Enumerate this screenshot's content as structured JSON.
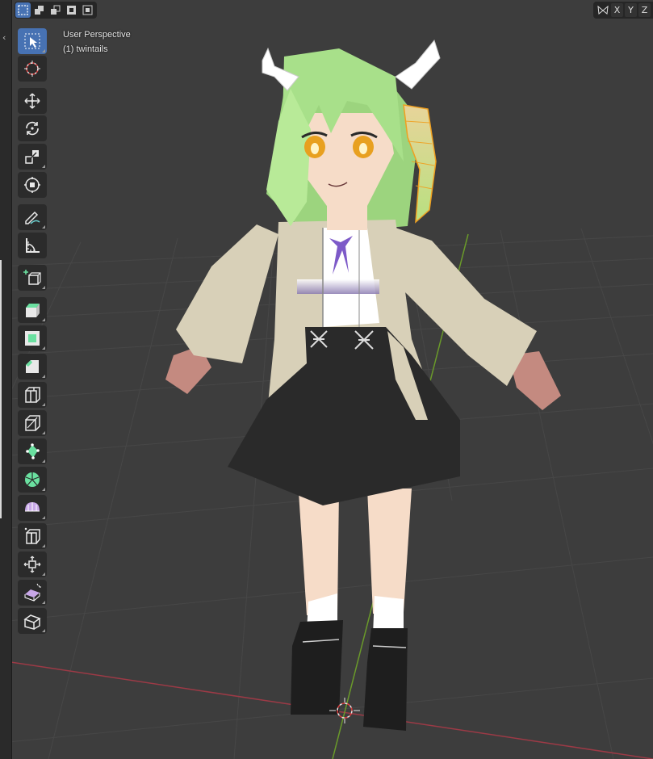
{
  "header": {
    "select_modes": [
      "select-box-icon",
      "select-extend-icon",
      "select-subtract-icon",
      "select-invert-icon",
      "select-intersect-icon"
    ],
    "active_mode": 0,
    "mirror_icon": "butterfly-icon",
    "axes": [
      "X",
      "Y",
      "Z"
    ]
  },
  "viewport": {
    "view_name": "User Perspective",
    "object_name": "(1) twintails"
  },
  "toolbar": {
    "tools": [
      {
        "name": "select-box",
        "icon": "cursor-arrow-icon",
        "active": true
      },
      {
        "name": "cursor",
        "icon": "3d-cursor-icon"
      },
      {
        "name": "move",
        "icon": "move-arrows-icon"
      },
      {
        "name": "rotate",
        "icon": "rotate-icon"
      },
      {
        "name": "scale",
        "icon": "scale-icon"
      },
      {
        "name": "transform",
        "icon": "transform-icon"
      },
      {
        "name": "annotate",
        "icon": "pencil-icon"
      },
      {
        "name": "measure",
        "icon": "ruler-icon"
      },
      {
        "name": "add-cube",
        "icon": "add-cube-icon"
      },
      {
        "name": "extrude",
        "icon": "extrude-icon"
      },
      {
        "name": "inset",
        "icon": "inset-icon"
      },
      {
        "name": "bevel",
        "icon": "bevel-icon"
      },
      {
        "name": "loop-cut",
        "icon": "loop-cut-icon"
      },
      {
        "name": "knife",
        "icon": "knife-icon"
      },
      {
        "name": "poly-build",
        "icon": "poly-build-icon"
      },
      {
        "name": "spin",
        "icon": "spin-icon"
      },
      {
        "name": "smooth",
        "icon": "smooth-icon"
      },
      {
        "name": "edge-slide",
        "icon": "edge-slide-icon"
      },
      {
        "name": "shrink-fatten",
        "icon": "shrink-fatten-icon"
      },
      {
        "name": "shear",
        "icon": "shear-icon"
      },
      {
        "name": "rip",
        "icon": "rip-icon"
      }
    ]
  },
  "colors": {
    "background": "#3d3d3d",
    "grid": "#4a4a4a",
    "x_axis": "#9c3a46",
    "y_axis": "#6a9a2a",
    "hair": "#a8e08a",
    "coat": "#d8d0b8",
    "skirt": "#2a2a2a",
    "skin": "#f6dcc8",
    "selected_edge": "#f0a020",
    "active_button": "#4772b3"
  }
}
